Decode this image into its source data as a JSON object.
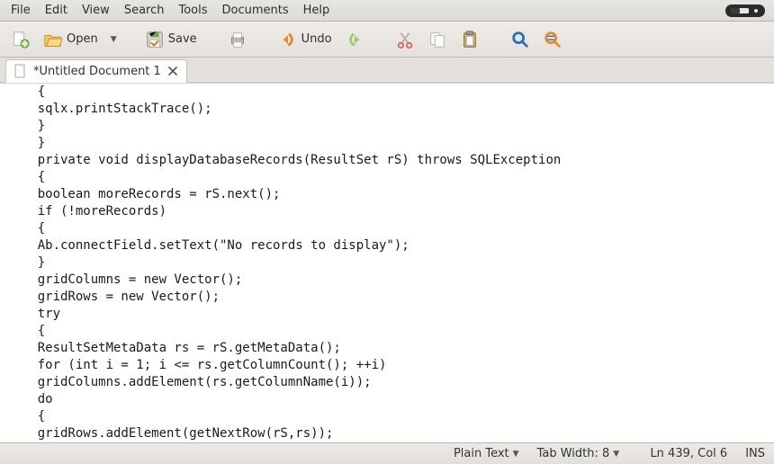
{
  "menu": {
    "items": [
      "File",
      "Edit",
      "View",
      "Search",
      "Tools",
      "Documents",
      "Help"
    ]
  },
  "toolbar": {
    "open_label": "Open",
    "save_label": "Save",
    "undo_label": "Undo"
  },
  "tab": {
    "label": "*Untitled Document 1"
  },
  "code_lines": [
    "    {",
    "    sqlx.printStackTrace();",
    "    }",
    "    }",
    "    private void displayDatabaseRecords(ResultSet rS) throws SQLException",
    "    {",
    "    boolean moreRecords = rS.next();",
    "    if (!moreRecords)",
    "    {",
    "    Ab.connectField.setText(\"No records to display\");",
    "    }",
    "    gridColumns = new Vector();",
    "    gridRows = new Vector();",
    "    try",
    "    {",
    "    ResultSetMetaData rs = rS.getMetaData();",
    "    for (int i = 1; i <= rs.getColumnCount(); ++i)",
    "    gridColumns.addElement(rs.getColumnName(i));",
    "    do",
    "    {",
    "    gridRows.addElement(getNextRow(rS,rs));"
  ],
  "status": {
    "syntax": "Plain Text",
    "tabwidth": "Tab Width: 8",
    "position": "Ln 439, Col 6",
    "insert": "INS"
  }
}
